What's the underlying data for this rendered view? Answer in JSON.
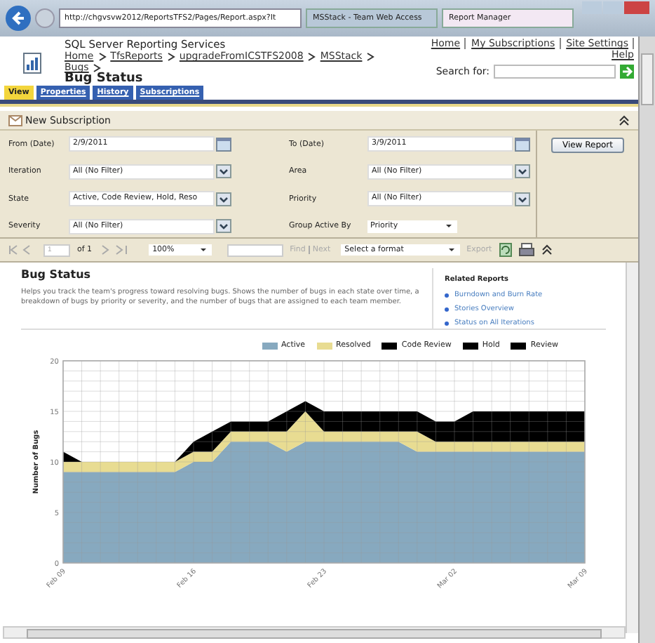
{
  "browser": {
    "url": "http://chgvsvw2012/ReportsTFS2/Pages/Report.aspx?It",
    "tabs": [
      {
        "label": "MSStack - Team Web Access",
        "selected": false
      },
      {
        "label": "Report Manager",
        "selected": true
      }
    ]
  },
  "header": {
    "product": "SQL Server Reporting Services",
    "breadcrumb": [
      "Home",
      "TfsReports",
      "upgradeFromICSTFS2008",
      "MSStack",
      "Bugs"
    ],
    "title": "Bug Status",
    "links": [
      "Home",
      "My Subscriptions",
      "Site Settings",
      "Help"
    ],
    "search_label": "Search for:"
  },
  "tabs": [
    {
      "label": "View",
      "selected": true
    },
    {
      "label": "Properties",
      "selected": false
    },
    {
      "label": "History",
      "selected": false
    },
    {
      "label": "Subscriptions",
      "selected": false
    }
  ],
  "subscription_bar": {
    "label": "New Subscription"
  },
  "parameters": [
    {
      "label": "From (Date)",
      "value": "2/9/2011",
      "kind": "date"
    },
    {
      "label": "To (Date)",
      "value": "3/9/2011",
      "kind": "date"
    },
    {
      "label": "Iteration",
      "value": "All (No Filter)",
      "kind": "select"
    },
    {
      "label": "Area",
      "value": "All (No Filter)",
      "kind": "select"
    },
    {
      "label": "State",
      "value": "Active, Code Review, Hold, Reso",
      "kind": "select"
    },
    {
      "label": "Priority",
      "value": "All (No Filter)",
      "kind": "select"
    },
    {
      "label": "Severity",
      "value": "All (No Filter)",
      "kind": "select"
    },
    {
      "label": "Group Active By",
      "value": "Priority",
      "kind": "dropdown"
    }
  ],
  "view_report_button": "View Report",
  "toolbar": {
    "page": "1",
    "of": "of 1",
    "zoom": "100%",
    "find": "Find",
    "next": "Next",
    "format": "Select a format",
    "export": "Export"
  },
  "report": {
    "title": "Bug Status",
    "description": "Helps you track the team's progress toward resolving bugs. Shows the number of bugs in each state over time, a breakdown of bugs by priority or severity, and the number of bugs that are assigned to each team member.",
    "related_title": "Related Reports",
    "related": [
      "Burndown and Burn Rate",
      "Stories Overview",
      "Status on All Iterations"
    ],
    "chart_data": {
      "type": "area",
      "stacked": true,
      "ylabel": "Number of Bugs",
      "categories": [
        "Feb 09",
        null,
        null,
        null,
        null,
        null,
        null,
        "Feb 16",
        null,
        null,
        null,
        null,
        null,
        null,
        "Feb 23",
        null,
        null,
        null,
        null,
        null,
        null,
        "Mar 02",
        null,
        null,
        null,
        null,
        null,
        null,
        "Mar 09"
      ],
      "ylim": [
        0,
        20
      ],
      "yticks": [
        0,
        5,
        10,
        15,
        20
      ],
      "series": [
        {
          "name": "Active",
          "color": "#87a9bf",
          "values": [
            9,
            9,
            9,
            9,
            9,
            9,
            9,
            10,
            10,
            12,
            12,
            12,
            11,
            12,
            12,
            12,
            12,
            12,
            12,
            11,
            11,
            11,
            11,
            11,
            11,
            11,
            11,
            11,
            11
          ]
        },
        {
          "name": "Resolved",
          "color": "#e8dc92",
          "values": [
            1,
            1,
            1,
            1,
            1,
            1,
            1,
            1,
            1,
            1,
            1,
            1,
            2,
            3,
            1,
            1,
            1,
            1,
            1,
            2,
            1,
            1,
            1,
            1,
            1,
            1,
            1,
            1,
            1
          ]
        },
        {
          "name": "Code Review",
          "color": "#000000",
          "values": [
            1,
            0,
            0,
            0,
            0,
            0,
            0,
            1,
            2,
            1,
            1,
            1,
            2,
            1,
            2,
            2,
            2,
            2,
            2,
            2,
            2,
            2,
            3,
            3,
            3,
            3,
            3,
            3,
            3
          ]
        },
        {
          "name": "Hold",
          "color": "#000000",
          "values": [
            null,
            null,
            null,
            null,
            null,
            null,
            null,
            null,
            null,
            null,
            null,
            null,
            null,
            null,
            null,
            null,
            null,
            null,
            null,
            null,
            null,
            null,
            null,
            null,
            null,
            null,
            null,
            null,
            null
          ]
        },
        {
          "name": "Review",
          "color": "#000000",
          "values": [
            null,
            null,
            null,
            null,
            null,
            null,
            null,
            null,
            null,
            null,
            null,
            null,
            null,
            null,
            null,
            null,
            null,
            null,
            null,
            null,
            null,
            null,
            null,
            null,
            null,
            null,
            null,
            null,
            null
          ]
        }
      ],
      "grid": true
    }
  }
}
